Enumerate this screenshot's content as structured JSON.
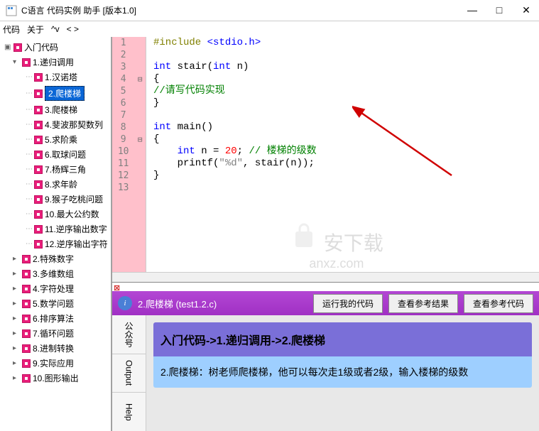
{
  "window": {
    "title": "C语言 代码实例 助手  [版本1.0]",
    "controls": {
      "min": "—",
      "max": "□",
      "close": "✕"
    }
  },
  "menu": {
    "items": [
      "代码",
      "关于",
      "^v",
      "< >"
    ]
  },
  "tree": {
    "root": "入门代码",
    "sections": [
      {
        "label": "1.递归调用",
        "children": [
          {
            "label": "1.汉诺塔"
          },
          {
            "label": "2.爬楼梯",
            "selected": true
          },
          {
            "label": "3.爬楼梯"
          },
          {
            "label": "4.斐波那契数列"
          },
          {
            "label": "5.求阶乘"
          },
          {
            "label": "6.取球问题"
          },
          {
            "label": "7.杨辉三角"
          },
          {
            "label": "8.求年龄"
          },
          {
            "label": "9.猴子吃桃问题"
          },
          {
            "label": "10.最大公约数"
          },
          {
            "label": "11.逆序输出数字"
          },
          {
            "label": "12.逆序输出字符"
          }
        ]
      },
      {
        "label": "2.特殊数字"
      },
      {
        "label": "3.多维数组"
      },
      {
        "label": "4.字符处理"
      },
      {
        "label": "5.数学问题"
      },
      {
        "label": "6.排序算法"
      },
      {
        "label": "7.循环问题"
      },
      {
        "label": "8.进制转换"
      },
      {
        "label": "9.实际应用"
      },
      {
        "label": "10.图形输出"
      }
    ]
  },
  "code": {
    "lines": [
      {
        "n": 1,
        "fold": "",
        "tokens": [
          {
            "t": "#include ",
            "c": "pp"
          },
          {
            "t": "<stdio.h>",
            "c": "inc"
          }
        ]
      },
      {
        "n": 2,
        "fold": "",
        "tokens": []
      },
      {
        "n": 3,
        "fold": "",
        "tokens": [
          {
            "t": "int",
            "c": "kw"
          },
          {
            "t": " stair(",
            "c": "txt"
          },
          {
            "t": "int",
            "c": "kw"
          },
          {
            "t": " n)",
            "c": "txt"
          }
        ]
      },
      {
        "n": 4,
        "fold": "⊟",
        "tokens": [
          {
            "t": "{",
            "c": "txt"
          }
        ]
      },
      {
        "n": 5,
        "fold": "",
        "tokens": [
          {
            "t": "//请写代码实现",
            "c": "cmt"
          }
        ]
      },
      {
        "n": 6,
        "fold": "",
        "tokens": [
          {
            "t": "}",
            "c": "txt"
          }
        ]
      },
      {
        "n": 7,
        "fold": "",
        "tokens": []
      },
      {
        "n": 8,
        "fold": "",
        "tokens": [
          {
            "t": "int",
            "c": "kw"
          },
          {
            "t": " main()",
            "c": "txt"
          }
        ]
      },
      {
        "n": 9,
        "fold": "⊟",
        "tokens": [
          {
            "t": "{",
            "c": "txt"
          }
        ]
      },
      {
        "n": 10,
        "fold": "",
        "tokens": [
          {
            "t": "    ",
            "c": "txt"
          },
          {
            "t": "int",
            "c": "kw"
          },
          {
            "t": " n = ",
            "c": "txt"
          },
          {
            "t": "20",
            "c": "num-lit"
          },
          {
            "t": "; ",
            "c": "txt"
          },
          {
            "t": "// 楼梯的级数",
            "c": "cmt"
          }
        ]
      },
      {
        "n": 11,
        "fold": "",
        "tokens": [
          {
            "t": "    printf(",
            "c": "txt"
          },
          {
            "t": "\"%d\"",
            "c": "str"
          },
          {
            "t": ", stair(n));",
            "c": "txt"
          }
        ]
      },
      {
        "n": 12,
        "fold": "",
        "tokens": [
          {
            "t": "}",
            "c": "txt"
          }
        ]
      },
      {
        "n": 13,
        "fold": "",
        "tokens": []
      }
    ]
  },
  "watermark": {
    "main": "安下载",
    "sub": "anxz.com"
  },
  "info": {
    "title": "2.爬楼梯 (test1.2.c)",
    "buttons": {
      "run": "运行我的代码",
      "result": "查看参考结果",
      "refcode": "查看参考代码"
    },
    "tabs": [
      "公众号",
      "Output",
      "Help"
    ],
    "breadcrumb": "入门代码->1.递归调用->2.爬楼梯",
    "desc": "2.爬楼梯：树老师爬楼梯，他可以每次走1级或者2级，输入楼梯的级数"
  }
}
